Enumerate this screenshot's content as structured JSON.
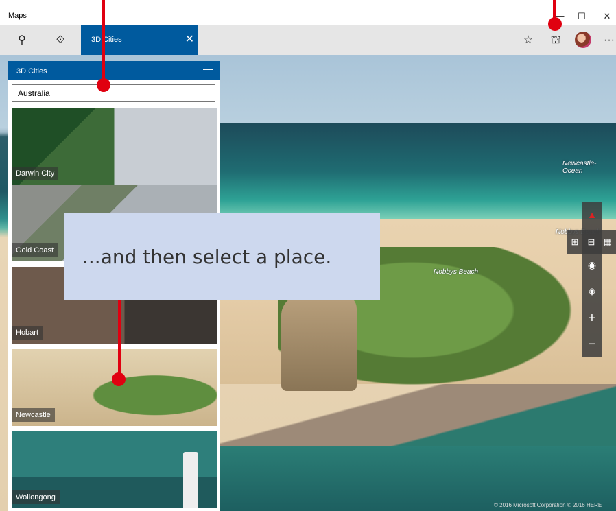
{
  "window": {
    "title": "Maps",
    "minimize_glyph": "—",
    "maximize_glyph": "☐",
    "close_glyph": "✕"
  },
  "toolbar": {
    "search_glyph": "⚲",
    "directions_glyph": "⟐",
    "active_tab_label": "3D Cities",
    "active_tab_close": "✕",
    "favorites_glyph": "☆",
    "cities_glyph": "⛫",
    "more_glyph": "···"
  },
  "panel": {
    "title": "3D Cities",
    "minimize_glyph": "—",
    "search_value": "Australia",
    "cities": [
      {
        "label": "Darwin City"
      },
      {
        "label": "Gold Coast"
      },
      {
        "label": "Hobart"
      },
      {
        "label": "Newcastle"
      },
      {
        "label": "Wollongong"
      }
    ]
  },
  "map": {
    "labels": {
      "ocean": "Newcastle-Ocean",
      "beach1": "Nobbys Beach",
      "beach2": "Nobbys Beach"
    },
    "controls": {
      "compass": "▲",
      "tilt1": "⊞",
      "tilt2": "⊟",
      "tilt3": "▦",
      "locate": "◉",
      "layers": "◈",
      "zoom_in": "+",
      "zoom_out": "−"
    },
    "copyright": "© 2016 Microsoft Corporation  © 2016 HERE"
  },
  "callout": {
    "text": "...and then select a place."
  },
  "colors": {
    "accent": "#005a9e",
    "annotation": "#e00010",
    "callout_bg": "#cdd8ee"
  }
}
